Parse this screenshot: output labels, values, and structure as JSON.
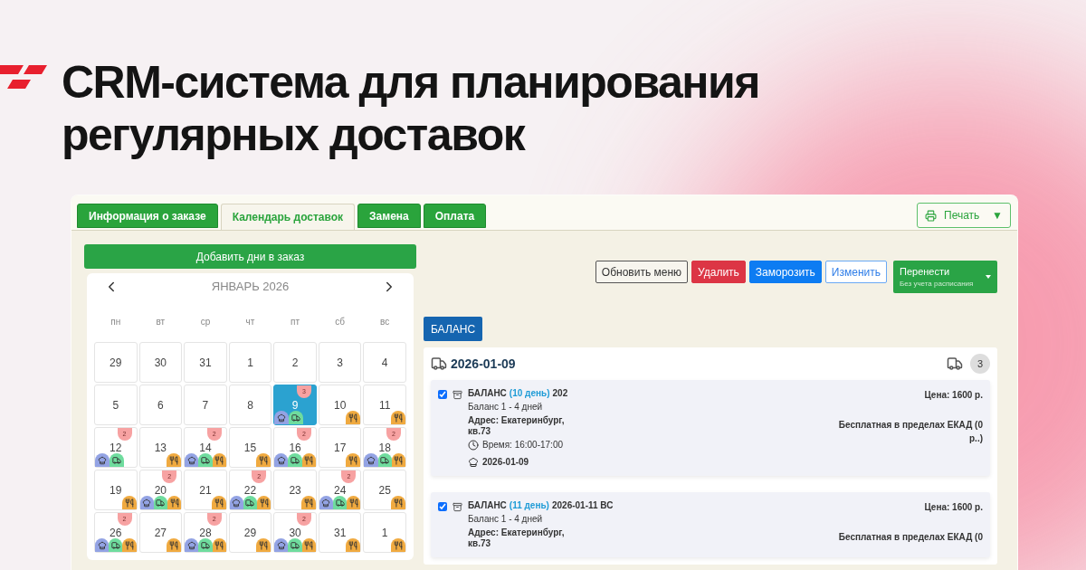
{
  "headline": [
    "CRM-система для планирования",
    "регулярных доставок"
  ],
  "tabs": [
    {
      "label": "Информация о заказе",
      "selected": false
    },
    {
      "label": "Календарь доставок",
      "selected": true
    },
    {
      "label": "Замена",
      "selected": false
    },
    {
      "label": "Оплата",
      "selected": false
    }
  ],
  "print_button": {
    "label": "Печать",
    "caret": "▼"
  },
  "add_days_button": "Добавить дни в заказ",
  "calendar": {
    "month": "ЯНВАРЬ 2026",
    "weekdays": [
      "пн",
      "вт",
      "ср",
      "чт",
      "пт",
      "сб",
      "вс"
    ],
    "days": [
      {
        "day": "29",
        "selected": false
      },
      {
        "day": "30",
        "selected": false
      },
      {
        "day": "31",
        "selected": false
      },
      {
        "day": "1",
        "selected": false
      },
      {
        "day": "2",
        "selected": false
      },
      {
        "day": "3",
        "selected": false
      },
      {
        "day": "4",
        "selected": false
      },
      {
        "day": "5",
        "selected": false
      },
      {
        "day": "6",
        "selected": false
      },
      {
        "day": "7",
        "selected": false
      },
      {
        "day": "8",
        "selected": false
      },
      {
        "day": "9",
        "selected": true,
        "badge": "3",
        "markers": [
          {
            "kind": "chef"
          },
          {
            "kind": "truck"
          }
        ]
      },
      {
        "day": "10",
        "selected": false,
        "markers": [
          {
            "kind": "food"
          }
        ]
      },
      {
        "day": "11",
        "selected": false,
        "markers": [
          {
            "kind": "food"
          }
        ]
      },
      {
        "day": "12",
        "selected": false,
        "badge": "2",
        "markers": [
          {
            "kind": "chef"
          },
          {
            "kind": "truck"
          }
        ]
      },
      {
        "day": "13",
        "selected": false,
        "markers": [
          {
            "kind": "food"
          }
        ]
      },
      {
        "day": "14",
        "selected": false,
        "badge": "2",
        "markers": [
          {
            "kind": "chef"
          },
          {
            "kind": "truck"
          },
          {
            "kind": "food"
          }
        ]
      },
      {
        "day": "15",
        "selected": false,
        "markers": [
          {
            "kind": "food"
          }
        ]
      },
      {
        "day": "16",
        "selected": false,
        "badge": "2",
        "markers": [
          {
            "kind": "chef"
          },
          {
            "kind": "truck"
          },
          {
            "kind": "food"
          }
        ]
      },
      {
        "day": "17",
        "selected": false,
        "markers": [
          {
            "kind": "food"
          }
        ]
      },
      {
        "day": "18",
        "selected": false,
        "badge": "2",
        "markers": [
          {
            "kind": "chef"
          },
          {
            "kind": "truck"
          },
          {
            "kind": "food"
          }
        ]
      },
      {
        "day": "19",
        "selected": false,
        "markers": [
          {
            "kind": "food"
          }
        ]
      },
      {
        "day": "20",
        "selected": false,
        "badge": "2",
        "markers": [
          {
            "kind": "chef"
          },
          {
            "kind": "truck"
          },
          {
            "kind": "food"
          }
        ]
      },
      {
        "day": "21",
        "selected": false,
        "markers": [
          {
            "kind": "food"
          }
        ]
      },
      {
        "day": "22",
        "selected": false,
        "badge": "2",
        "markers": [
          {
            "kind": "chef"
          },
          {
            "kind": "truck"
          },
          {
            "kind": "food"
          }
        ]
      },
      {
        "day": "23",
        "selected": false,
        "markers": [
          {
            "kind": "food"
          }
        ]
      },
      {
        "day": "24",
        "selected": false,
        "badge": "2",
        "markers": [
          {
            "kind": "chef"
          },
          {
            "kind": "truck"
          },
          {
            "kind": "food"
          }
        ]
      },
      {
        "day": "25",
        "selected": false,
        "markers": [
          {
            "kind": "food"
          }
        ]
      },
      {
        "day": "26",
        "selected": false,
        "badge": "2",
        "markers": [
          {
            "kind": "chef"
          },
          {
            "kind": "truck"
          },
          {
            "kind": "food"
          }
        ]
      },
      {
        "day": "27",
        "selected": false,
        "markers": [
          {
            "kind": "food"
          }
        ]
      },
      {
        "day": "28",
        "selected": false,
        "badge": "2",
        "markers": [
          {
            "kind": "chef"
          },
          {
            "kind": "truck"
          },
          {
            "kind": "food"
          }
        ]
      },
      {
        "day": "29",
        "selected": false,
        "markers": [
          {
            "kind": "food"
          }
        ]
      },
      {
        "day": "30",
        "selected": false,
        "badge": "2",
        "markers": [
          {
            "kind": "chef"
          },
          {
            "kind": "truck"
          },
          {
            "kind": "food"
          }
        ]
      },
      {
        "day": "31",
        "selected": false,
        "markers": [
          {
            "kind": "food"
          }
        ]
      },
      {
        "day": "1",
        "selected": false,
        "markers": [
          {
            "kind": "food"
          }
        ]
      }
    ]
  },
  "actions": [
    {
      "kind": "outline",
      "label": "Обновить меню"
    },
    {
      "kind": "danger",
      "label": "Удалить"
    },
    {
      "kind": "primary",
      "label": "Заморозить"
    },
    {
      "kind": "outline-primary",
      "label": "Изменить"
    },
    {
      "kind": "split",
      "label": "Перенести",
      "sublabel": "Без учета расписания"
    }
  ],
  "program_button": "БАЛАНС",
  "delivery": {
    "date": "2026-01-09",
    "count": "3",
    "items": [
      {
        "checked": true,
        "title": "БАЛАНС",
        "day": "(10 день)",
        "date": "202",
        "plan": "Баланс 1 - 4 дней",
        "address": "Адрес: Екатеринбург, кв.73",
        "time": "Время: 16:00-17:00",
        "menu_date": "2026-01-09",
        "price": "Цена: 1600 р.",
        "delivery_cost": "Бесплатная в пределах ЕКАД (0 р..)"
      },
      {
        "checked": true,
        "title": "БАЛАНС",
        "day": "(11 день)",
        "date": "2026-01-11 ВС",
        "plan": "Баланс 1 - 4 дней",
        "address": "Адрес: Екатеринбург, кв.73",
        "price": "Цена: 1600 р.",
        "delivery_cost": "Бесплатная в пределах ЕКАД (0"
      }
    ]
  }
}
